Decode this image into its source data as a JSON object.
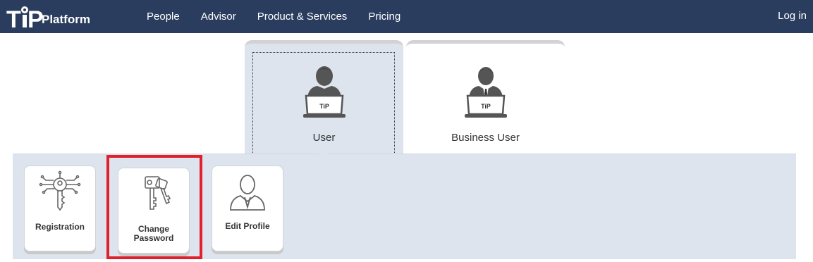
{
  "header": {
    "logo_mark": "TiP",
    "logo_text": "Platform",
    "nav": [
      "People",
      "Advisor",
      "Product & Services",
      "Pricing"
    ],
    "login_label": "Log in"
  },
  "user_tabs": [
    {
      "label": "User",
      "icon": "user-laptop-icon",
      "laptop_text": "TiP"
    },
    {
      "label": "Business User",
      "icon": "business-user-laptop-icon",
      "laptop_text": "TiP"
    }
  ],
  "actions": [
    {
      "label": "Registration",
      "icon": "key-circuit-icon"
    },
    {
      "label_line1": "Change",
      "label_line2": "Password",
      "icon": "keys-icon"
    },
    {
      "label": "Edit Profile",
      "icon": "person-icon"
    }
  ],
  "colors": {
    "topbar": "#2b3d5e",
    "panel": "#dde4ee",
    "highlight": "#e0202b"
  }
}
